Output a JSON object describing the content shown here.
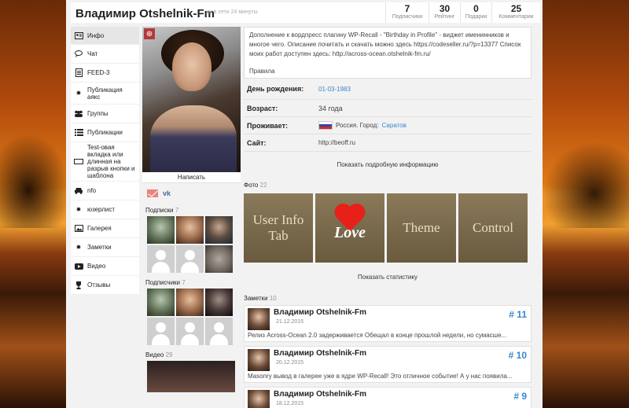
{
  "header": {
    "username": "Владимир Otshelnik-Fm",
    "online_status": "не в сети 24 минуты",
    "stats": [
      {
        "value": "7",
        "label": "Подписчики"
      },
      {
        "value": "30",
        "label": "Рейтинг"
      },
      {
        "value": "0",
        "label": "Подарки"
      },
      {
        "value": "25",
        "label": "Комментарии"
      }
    ]
  },
  "menu": [
    {
      "label": "Инфо",
      "icon": "user-card-icon"
    },
    {
      "label": "Чат",
      "icon": "chat-icon"
    },
    {
      "label": "FEED-3",
      "icon": "document-icon"
    },
    {
      "label": "Публикация аякс",
      "icon": "gear-icon"
    },
    {
      "label": "Группы",
      "icon": "group-icon"
    },
    {
      "label": "Публикации",
      "icon": "list-icon"
    },
    {
      "label": "Test-овая вкладка или длинная на разрыв кнопки и шаблона",
      "icon": "rectangle-icon"
    },
    {
      "label": "nfo",
      "icon": "car-icon"
    },
    {
      "label": "юзерлист",
      "icon": "gear-icon"
    },
    {
      "label": "Галерея",
      "icon": "image-icon"
    },
    {
      "label": "Заметки",
      "icon": "gear-icon"
    },
    {
      "label": "Видео",
      "icon": "youtube-icon"
    },
    {
      "label": "Отзывы",
      "icon": "trophy-icon"
    }
  ],
  "profile": {
    "write_button": "Написать",
    "social_vk": "vk",
    "subscriptions_title": "Подписки",
    "subscriptions_count": "7",
    "subscribers_title": "Подписчики",
    "subscribers_count": "7",
    "video_title": "Видео",
    "video_count": "29"
  },
  "about": {
    "text": "Дополнение к вордпресс плагину WP-Recall - \"Birthday in Profile\" - виджет именинников и многое чего. Описание почитать и скачать можно здесь https://codeseller.ru/?p=13377 Список моих работ доступен здесь: http://across-ocean.otshelnik-fm.ru/",
    "rules": "Правила"
  },
  "details": {
    "birthday_label": "День рождения:",
    "birthday_value": "01-03-1983",
    "age_label": "Возраст:",
    "age_value": "34 года",
    "lives_label": "Проживает:",
    "lives_country": "Россия. Город:",
    "lives_city": "Саратов",
    "site_label": "Сайт:",
    "site_value": "http://beoff.ru",
    "show_more": "Показать подробную информацию"
  },
  "photos": {
    "title": "Фото",
    "count": "22",
    "items": [
      "User Info Tab",
      "Love",
      "Theme",
      "Control"
    ],
    "show_stats": "Показать статистику"
  },
  "notes": {
    "title": "Заметки",
    "count": "10",
    "items": [
      {
        "author": "Владимир Otshelnik-Fm",
        "date": "21.12.2015",
        "number": "# 11",
        "text": "Релиз Across-Ocean 2.0 задерживается Обещал в конце прошлой недели, но сумасше..."
      },
      {
        "author": "Владимир Otshelnik-Fm",
        "date": "20.12.2015",
        "number": "# 10",
        "text": "Masonry вывод в галерее уже в ядре WP-Recall! Это отличное событие! А у нас появила..."
      },
      {
        "author": "Владимир Otshelnik-Fm",
        "date": "18.12.2015",
        "number": "# 9",
        "text": ""
      }
    ]
  }
}
